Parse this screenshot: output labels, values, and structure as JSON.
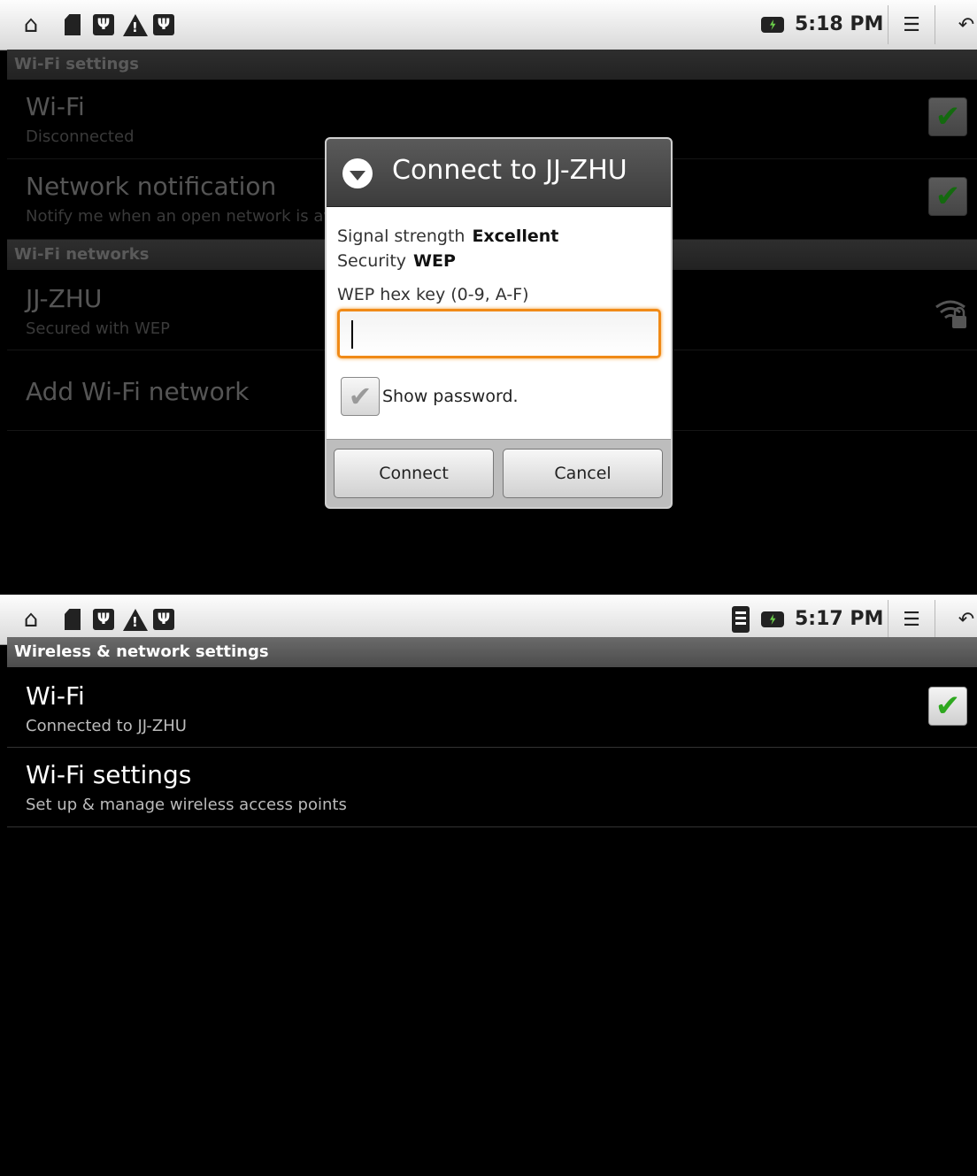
{
  "screen1": {
    "statusbar": {
      "time": "5:18 PM",
      "icons": [
        "home-icon",
        "sd-card-icon",
        "usb-icon",
        "warning-icon",
        "usb-icon",
        "battery-icon",
        "menu-icon",
        "back-icon"
      ]
    },
    "section_wifi_settings": "Wi-Fi settings",
    "wifi_pref": {
      "title": "Wi-Fi",
      "summary": "Disconnected",
      "checked": true
    },
    "notification_pref": {
      "title": "Network notification",
      "summary": "Notify me when an open network is available",
      "checked": true
    },
    "section_networks": "Wi-Fi networks",
    "network": {
      "ssid": "JJ-ZHU",
      "summary": "Secured with WEP",
      "icon": "wifi-lock-icon"
    },
    "add_network": "Add Wi-Fi network",
    "dialog": {
      "title": "Connect to JJ-ZHU",
      "signal_label": "Signal strength",
      "signal_value": "Excellent",
      "security_label": "Security",
      "security_value": "WEP",
      "key_label": "WEP hex key (0-9, A-F)",
      "key_value": "",
      "show_password": "Show password.",
      "show_password_checked": true,
      "connect": "Connect",
      "cancel": "Cancel"
    }
  },
  "screen2": {
    "statusbar": {
      "time": "5:17 PM",
      "icons": [
        "home-icon",
        "sd-card-icon",
        "usb-icon",
        "warning-icon",
        "usb-icon",
        "wifi-signal-icon",
        "battery-icon",
        "menu-icon",
        "back-icon"
      ]
    },
    "section": "Wireless & network settings",
    "wifi_pref": {
      "title": "Wi-Fi",
      "summary": "Connected to JJ-ZHU",
      "checked": true
    },
    "wifi_settings_pref": {
      "title": "Wi-Fi settings",
      "summary": "Set up & manage wireless access points"
    }
  },
  "colors": {
    "accent_orange": "#f08a17",
    "check_green": "#2ea81f",
    "section_bg": "#5a5a5a"
  }
}
